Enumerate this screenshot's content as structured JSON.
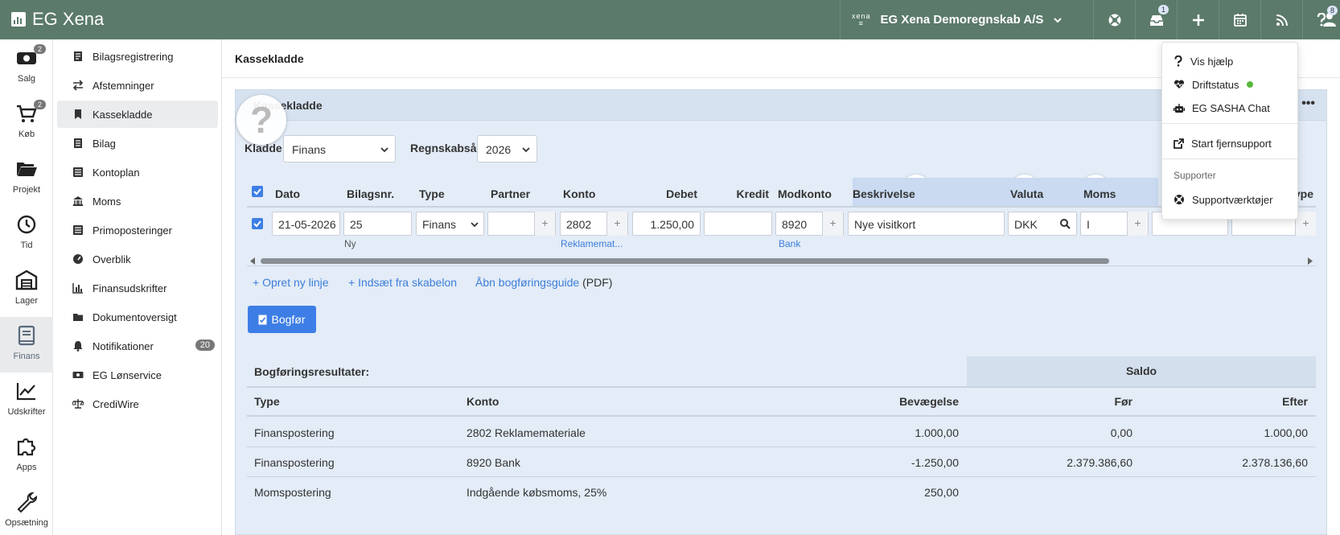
{
  "app": {
    "name": "EG Xena"
  },
  "topbar": {
    "company_logo": "xena",
    "company_name": "EG Xena Demoregnskab A/S",
    "notifications_badge": "1",
    "user_badge": "8",
    "icons": [
      "support-lifebuoy-icon",
      "notifications-icon",
      "add-icon",
      "calendar-icon",
      "rss-icon",
      "help-icon",
      "user-icon"
    ]
  },
  "rail": {
    "items": [
      {
        "label": "Salg",
        "badge": "2"
      },
      {
        "label": "Køb",
        "badge": "2"
      },
      {
        "label": "Projekt"
      },
      {
        "label": "Tid"
      },
      {
        "label": "Lager"
      },
      {
        "label": "Finans"
      },
      {
        "label": "Udskrifter"
      },
      {
        "label": "Apps"
      },
      {
        "label": "Opsætning"
      }
    ]
  },
  "submenu": {
    "items": [
      {
        "label": "Bilagsregistrering"
      },
      {
        "label": "Afstemninger"
      },
      {
        "label": "Kassekladde"
      },
      {
        "label": "Bilag"
      },
      {
        "label": "Kontoplan"
      },
      {
        "label": "Moms"
      },
      {
        "label": "Primoposteringer"
      },
      {
        "label": "Overblik"
      },
      {
        "label": "Finansudskrifter"
      },
      {
        "label": "Dokumentoversigt"
      },
      {
        "label": "Notifikationer",
        "badge": "20"
      },
      {
        "label": "EG Lønservice"
      },
      {
        "label": "CrediWire"
      }
    ]
  },
  "main": {
    "title": "Kassekladde",
    "panel_title": "Kassekladde",
    "kladde_label": "Kladde",
    "kladde_value": "Finans",
    "regnskabsaar_label": "Regnskabsår",
    "regnskabsaar_value": "2026",
    "columns": [
      "Dato",
      "Bilagsnr.",
      "Type",
      "Partner",
      "Konto",
      "Debet",
      "Kredit",
      "Modkonto",
      "Beskrivelse",
      "Valuta",
      "Moms",
      "Type"
    ],
    "row": {
      "dato": "21-05-2026",
      "bilagsnr": "25",
      "bilagsnr_sub": "Ny",
      "type": "Finans",
      "partner": "",
      "konto": "2802",
      "konto_sub": "Reklamemat...",
      "debet": "1.250,00",
      "kredit": "",
      "modkonto": "8920",
      "modkonto_sub": "Bank",
      "beskrivelse": "Nye visitkort",
      "valuta": "DKK",
      "moms": "I"
    },
    "actions": {
      "new_line": "+ Opret ny linje",
      "insert_template": "+ Indsæt fra skabelon",
      "guide_link": "Åbn bogføringsguide",
      "guide_suffix": "(PDF)"
    },
    "bogfor_label": "Bogfør"
  },
  "results": {
    "title": "Bogføringsresultater:",
    "saldo_header": "Saldo",
    "columns": [
      "Type",
      "Konto",
      "Bevægelse",
      "Før",
      "Efter"
    ],
    "rows": [
      {
        "type": "Finanspostering",
        "konto": "2802 Reklamemateriale",
        "bevaegelse": "1.000,00",
        "foer": "0,00",
        "efter": "1.000,00"
      },
      {
        "type": "Finanspostering",
        "konto": "8920 Bank",
        "bevaegelse": "-1.250,00",
        "foer": "2.379.386,60",
        "efter": "2.378.136,60"
      },
      {
        "type": "Momspostering",
        "konto": "Indgående købsmoms, 25%",
        "bevaegelse": "250,00",
        "foer": "",
        "efter": ""
      }
    ]
  },
  "help_menu": {
    "items": [
      {
        "label": "Vis hjælp"
      },
      {
        "label": "Driftstatus"
      },
      {
        "label": "EG SASHA Chat"
      },
      {
        "label": "Start fjernsupport"
      }
    ],
    "section_header": "Supporter",
    "support_tools": "Supportværktøjer"
  },
  "colors": {
    "topbar": "#5b7a6a",
    "primary": "#3d7ee6",
    "link": "#3d7ed8",
    "panel": "#e3ecf7",
    "status_ok": "#59b83d"
  }
}
